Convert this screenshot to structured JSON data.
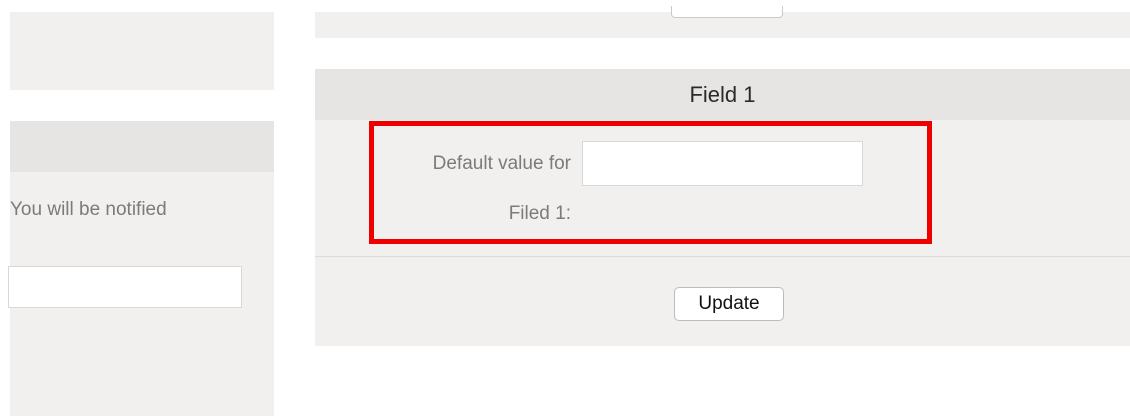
{
  "sidebar": {
    "notification_text": "You will be notified",
    "input_value": ""
  },
  "field_panel": {
    "title": "Field 1",
    "label_line1": "Default value for",
    "label_line2": "Filed 1:",
    "input_value": "",
    "update_label": "Update"
  },
  "highlight": {
    "color": "#ee0000"
  }
}
